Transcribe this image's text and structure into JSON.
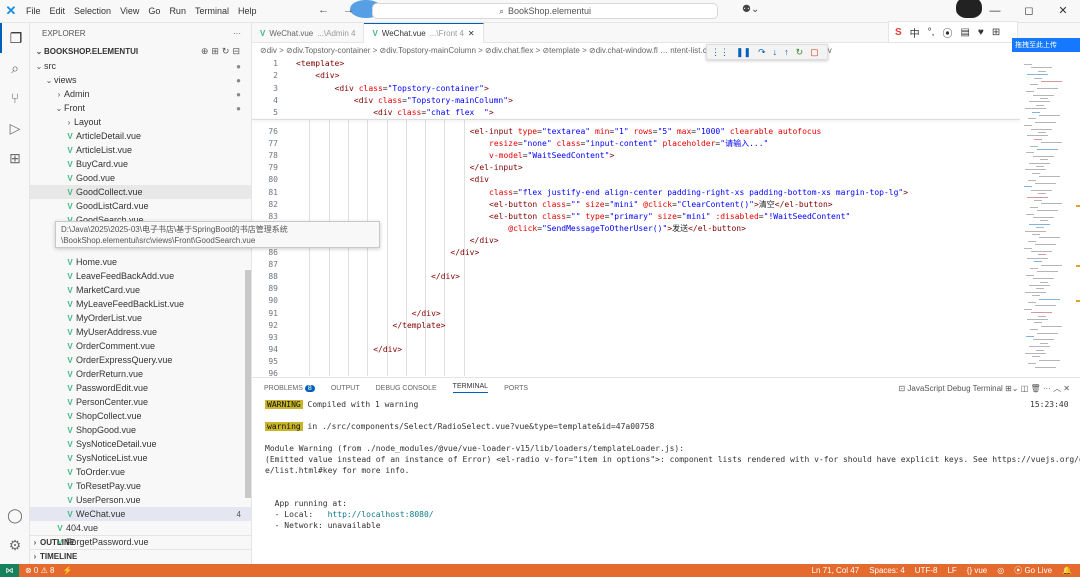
{
  "menu": [
    "File",
    "Edit",
    "Selection",
    "View",
    "Go",
    "Run",
    "Terminal",
    "Help"
  ],
  "title": {
    "search": "BookShop.elementui"
  },
  "ime": {
    "lang": "中"
  },
  "badge": {
    "label": "拖拽至此上传"
  },
  "explorer": {
    "title": "EXPLORER",
    "project": "BOOKSHOP.ELEMENTUI",
    "outline": "OUTLINE",
    "timeline": "TIMELINE",
    "tree": [
      {
        "label": "src",
        "depth": 0,
        "type": "folder",
        "open": true,
        "mod": "●"
      },
      {
        "label": "views",
        "depth": 1,
        "type": "folder",
        "open": true,
        "mod": "●"
      },
      {
        "label": "Admin",
        "depth": 2,
        "type": "folder",
        "open": false,
        "mod": "●"
      },
      {
        "label": "Front",
        "depth": 2,
        "type": "folder",
        "open": true,
        "mod": "●"
      },
      {
        "label": "Layout",
        "depth": 3,
        "type": "folder",
        "open": false
      },
      {
        "label": "ArticleDetail.vue",
        "depth": 3,
        "type": "vue"
      },
      {
        "label": "ArticleList.vue",
        "depth": 3,
        "type": "vue"
      },
      {
        "label": "BuyCard.vue",
        "depth": 3,
        "type": "vue"
      },
      {
        "label": "Good.vue",
        "depth": 3,
        "type": "vue"
      },
      {
        "label": "GoodCollect.vue",
        "depth": 3,
        "type": "vue",
        "focus": true
      },
      {
        "label": "GoodListCard.vue",
        "depth": 3,
        "type": "vue"
      },
      {
        "label": "GoodSearch.vue",
        "depth": 3,
        "type": "vue"
      },
      {
        "label": "",
        "depth": 3,
        "type": "blank"
      },
      {
        "label": "",
        "depth": 3,
        "type": "blank"
      },
      {
        "label": "Home.vue",
        "depth": 3,
        "type": "vue"
      },
      {
        "label": "LeaveFeedBackAdd.vue",
        "depth": 3,
        "type": "vue"
      },
      {
        "label": "MarketCard.vue",
        "depth": 3,
        "type": "vue"
      },
      {
        "label": "MyLeaveFeedBackList.vue",
        "depth": 3,
        "type": "vue"
      },
      {
        "label": "MyOrderList.vue",
        "depth": 3,
        "type": "vue"
      },
      {
        "label": "MyUserAddress.vue",
        "depth": 3,
        "type": "vue"
      },
      {
        "label": "OrderComment.vue",
        "depth": 3,
        "type": "vue"
      },
      {
        "label": "OrderExpressQuery.vue",
        "depth": 3,
        "type": "vue"
      },
      {
        "label": "OrderReturn.vue",
        "depth": 3,
        "type": "vue"
      },
      {
        "label": "PasswordEdit.vue",
        "depth": 3,
        "type": "vue"
      },
      {
        "label": "PersonCenter.vue",
        "depth": 3,
        "type": "vue"
      },
      {
        "label": "ShopCollect.vue",
        "depth": 3,
        "type": "vue"
      },
      {
        "label": "ShopGood.vue",
        "depth": 3,
        "type": "vue"
      },
      {
        "label": "SysNoticeDetail.vue",
        "depth": 3,
        "type": "vue"
      },
      {
        "label": "SysNoticeList.vue",
        "depth": 3,
        "type": "vue"
      },
      {
        "label": "ToOrder.vue",
        "depth": 3,
        "type": "vue"
      },
      {
        "label": "ToResetPay.vue",
        "depth": 3,
        "type": "vue"
      },
      {
        "label": "UserPerson.vue",
        "depth": 3,
        "type": "vue"
      },
      {
        "label": "WeChat.vue",
        "depth": 3,
        "type": "vue",
        "selected": true,
        "badge": "4"
      },
      {
        "label": "404.vue",
        "depth": 2,
        "type": "vue"
      },
      {
        "label": "ForgetPassword.vue",
        "depth": 2,
        "type": "vue"
      }
    ]
  },
  "tooltip": {
    "line1": "D:\\Java\\2025\\2025-03\\电子书店\\基于SpringBoot的书店管理系统",
    "line2": "\\BookShop.elementui\\src\\views\\Front\\GoodSearch.vue"
  },
  "tabs": [
    {
      "label": "WeChat.vue",
      "path": "...\\Admin 4"
    },
    {
      "label": "WeChat.vue",
      "path": "...\\Front 4"
    }
  ],
  "breadcrumb": "⊘div > ⊘div.Topstory-container > ⊘div.Topstory-mainColumn > ⊘div.chat.flex > ⊘template > ⊘div.chat-window.fl … ntent-list.chat-content-list > ⊘template > ⊘div",
  "code": [
    {
      "n": "1",
      "indent": 0,
      "parts": [
        [
          "tag",
          "<template>"
        ]
      ]
    },
    {
      "n": "2",
      "indent": 1,
      "parts": [
        [
          "tag",
          "<div>"
        ]
      ]
    },
    {
      "n": "3",
      "indent": 2,
      "parts": [
        [
          "tag",
          "<div "
        ],
        [
          "attr",
          "class"
        ],
        [
          "txt",
          "="
        ],
        [
          "val",
          "\"Topstory-container\""
        ],
        [
          "tag",
          ">"
        ]
      ]
    },
    {
      "n": "4",
      "indent": 3,
      "parts": [
        [
          "tag",
          "<div "
        ],
        [
          "attr",
          "class"
        ],
        [
          "txt",
          "="
        ],
        [
          "val",
          "\"Topstory-mainColumn\""
        ],
        [
          "tag",
          ">"
        ]
      ]
    },
    {
      "n": "5",
      "indent": 4,
      "parts": [
        [
          "tag",
          "<div "
        ],
        [
          "attr",
          "class"
        ],
        [
          "txt",
          "="
        ],
        [
          "val",
          "\"chat flex  \""
        ],
        [
          "tag",
          ">"
        ]
      ]
    },
    {
      "n": "76",
      "indent": 9,
      "parts": [
        [
          "tag",
          "<el-input "
        ],
        [
          "attr",
          "type"
        ],
        [
          "txt",
          "="
        ],
        [
          "val",
          "\"textarea\" "
        ],
        [
          "attr",
          "min"
        ],
        [
          "txt",
          "="
        ],
        [
          "val",
          "\"1\" "
        ],
        [
          "attr",
          "rows"
        ],
        [
          "txt",
          "="
        ],
        [
          "val",
          "\"5\" "
        ],
        [
          "attr",
          "max"
        ],
        [
          "txt",
          "="
        ],
        [
          "val",
          "\"1000\" "
        ],
        [
          "attr",
          "clearable autofocus"
        ]
      ]
    },
    {
      "n": "77",
      "indent": 10,
      "parts": [
        [
          "attr",
          "resize"
        ],
        [
          "txt",
          "="
        ],
        [
          "val",
          "\"none\" "
        ],
        [
          "attr",
          "class"
        ],
        [
          "txt",
          "="
        ],
        [
          "val",
          "\"input-content\" "
        ],
        [
          "attr",
          "placeholder"
        ],
        [
          "txt",
          "="
        ],
        [
          "val",
          "\"请输入...\""
        ]
      ]
    },
    {
      "n": "78",
      "indent": 10,
      "parts": [
        [
          "attr",
          "v-model"
        ],
        [
          "txt",
          "="
        ],
        [
          "val",
          "\"WaitSeedContent\""
        ],
        [
          "tag",
          ">"
        ]
      ]
    },
    {
      "n": "79",
      "indent": 9,
      "parts": [
        [
          "tag",
          "</el-input>"
        ]
      ]
    },
    {
      "n": "80",
      "indent": 9,
      "parts": [
        [
          "tag",
          "<div"
        ]
      ]
    },
    {
      "n": "81",
      "indent": 10,
      "parts": [
        [
          "attr",
          "class"
        ],
        [
          "txt",
          "="
        ],
        [
          "val",
          "\"flex justify-end align-center padding-right-xs padding-bottom-xs margin-top-lg\""
        ],
        [
          "tag",
          ">"
        ]
      ]
    },
    {
      "n": "82",
      "indent": 10,
      "parts": [
        [
          "tag",
          "<el-button "
        ],
        [
          "attr",
          "class"
        ],
        [
          "txt",
          "="
        ],
        [
          "val",
          "\"\" "
        ],
        [
          "attr",
          "size"
        ],
        [
          "txt",
          "="
        ],
        [
          "val",
          "\"mini\" "
        ],
        [
          "attr",
          "@click"
        ],
        [
          "txt",
          "="
        ],
        [
          "val",
          "\"ClearContent()\""
        ],
        [
          "tag",
          ">"
        ],
        [
          "txt",
          "清空"
        ],
        [
          "tag",
          "</el-button>"
        ]
      ]
    },
    {
      "n": "83",
      "indent": 10,
      "parts": [
        [
          "tag",
          "<el-button "
        ],
        [
          "attr",
          "class"
        ],
        [
          "txt",
          "="
        ],
        [
          "val",
          "\"\" "
        ],
        [
          "attr",
          "type"
        ],
        [
          "txt",
          "="
        ],
        [
          "val",
          "\"primary\" "
        ],
        [
          "attr",
          "size"
        ],
        [
          "txt",
          "="
        ],
        [
          "val",
          "\"mini\" "
        ],
        [
          "attr",
          ":disabled"
        ],
        [
          "txt",
          "="
        ],
        [
          "val",
          "\"!WaitSeedContent\""
        ]
      ]
    },
    {
      "n": "84",
      "indent": 11,
      "parts": [
        [
          "attr",
          "@click"
        ],
        [
          "txt",
          "="
        ],
        [
          "val",
          "\"SendMessageToOtherUser()\""
        ],
        [
          "tag",
          ">"
        ],
        [
          "txt",
          "发送"
        ],
        [
          "tag",
          "</el-button>"
        ]
      ]
    },
    {
      "n": "85",
      "indent": 9,
      "parts": [
        [
          "tag",
          "</div>"
        ]
      ]
    },
    {
      "n": "86",
      "indent": 8,
      "parts": [
        [
          "tag",
          "</div>"
        ]
      ]
    },
    {
      "n": "87",
      "indent": 0,
      "parts": []
    },
    {
      "n": "88",
      "indent": 7,
      "parts": [
        [
          "tag",
          "</div>"
        ]
      ]
    },
    {
      "n": "89",
      "indent": 0,
      "parts": []
    },
    {
      "n": "90",
      "indent": 0,
      "parts": []
    },
    {
      "n": "91",
      "indent": 6,
      "parts": [
        [
          "tag",
          "</div>"
        ]
      ]
    },
    {
      "n": "92",
      "indent": 5,
      "parts": [
        [
          "tag",
          "</template>"
        ]
      ]
    },
    {
      "n": "93",
      "indent": 0,
      "parts": []
    },
    {
      "n": "94",
      "indent": 4,
      "parts": [
        [
          "tag",
          "</div>"
        ]
      ]
    },
    {
      "n": "95",
      "indent": 0,
      "parts": []
    },
    {
      "n": "96",
      "indent": 0,
      "parts": []
    }
  ],
  "panel": {
    "tabs": [
      "PROBLEMS",
      "OUTPUT",
      "DEBUG CONSOLE",
      "TERMINAL",
      "PORTS"
    ],
    "problems_count": "8",
    "terminal_name": "JavaScript Debug Terminal",
    "lines": [
      {
        "chip": "WARNING",
        "text": " Compiled with 1 warning",
        "right": "15:23:40"
      },
      {
        "text": ""
      },
      {
        "chip": "warning",
        "text": " in ./src/components/Select/RadioSelect.vue?vue&type=template&id=47a00758"
      },
      {
        "text": ""
      },
      {
        "text": "Module Warning (from ./node_modules/@vue/vue-loader-v15/lib/loaders/templateLoader.js):"
      },
      {
        "text": "(Emitted value instead of an instance of Error) <el-radio v-for=\"item in options\">: component lists rendered with v-for should have explicit keys. See https://vuejs.org/guid"
      },
      {
        "text": "e/list.html#key for more info."
      },
      {
        "text": ""
      },
      {
        "text": ""
      },
      {
        "text": "  App running at:"
      },
      {
        "text": "  - Local:   ",
        "link": "http://localhost:8080/"
      },
      {
        "text": "  - Network: unavailable"
      }
    ]
  },
  "status": {
    "problems": "⊗ 0 ⚠ 8",
    "position": "Ln 71, Col 47",
    "spaces": "Spaces: 4",
    "encoding": "UTF-8",
    "eol": "LF",
    "language": "{} vue",
    "golive": "⦿ Go Live"
  }
}
